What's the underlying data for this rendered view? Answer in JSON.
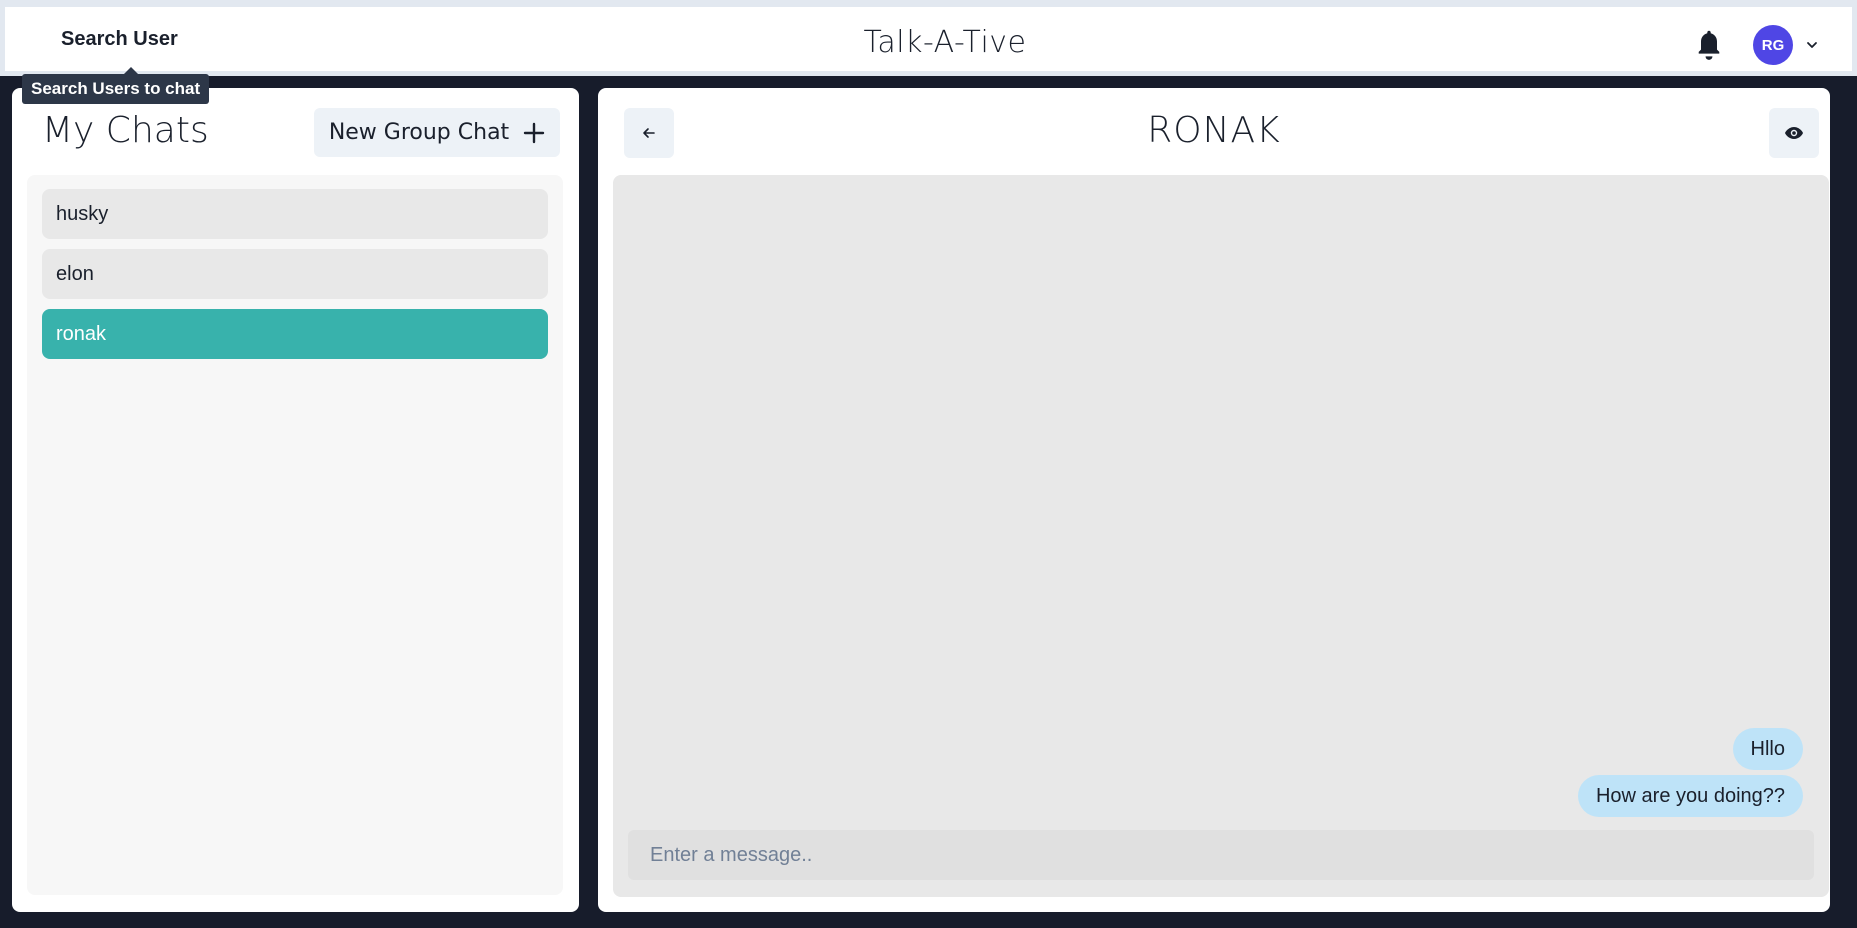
{
  "header": {
    "search_label": "Search User",
    "search_tooltip": "Search Users to chat",
    "app_title": "Talk-A-Tive",
    "avatar_initials": "RG"
  },
  "sidebar": {
    "title": "My Chats",
    "new_group_label": "New Group Chat",
    "chats": [
      {
        "name": "husky",
        "active": false
      },
      {
        "name": "elon",
        "active": false
      },
      {
        "name": "ronak",
        "active": true
      }
    ]
  },
  "chat": {
    "title": "RONAK",
    "messages": [
      {
        "text": "Hllo"
      },
      {
        "text": "How are you doing??"
      }
    ],
    "input_placeholder": "Enter a message.."
  },
  "colors": {
    "accent": "#38b2ac",
    "avatar_bg": "#4f46e5",
    "bubble": "#bee3f8",
    "background": "#171c2b"
  },
  "icons": [
    "bell-icon",
    "chevron-down-icon",
    "plus-icon",
    "arrow-left-icon",
    "eye-icon"
  ]
}
